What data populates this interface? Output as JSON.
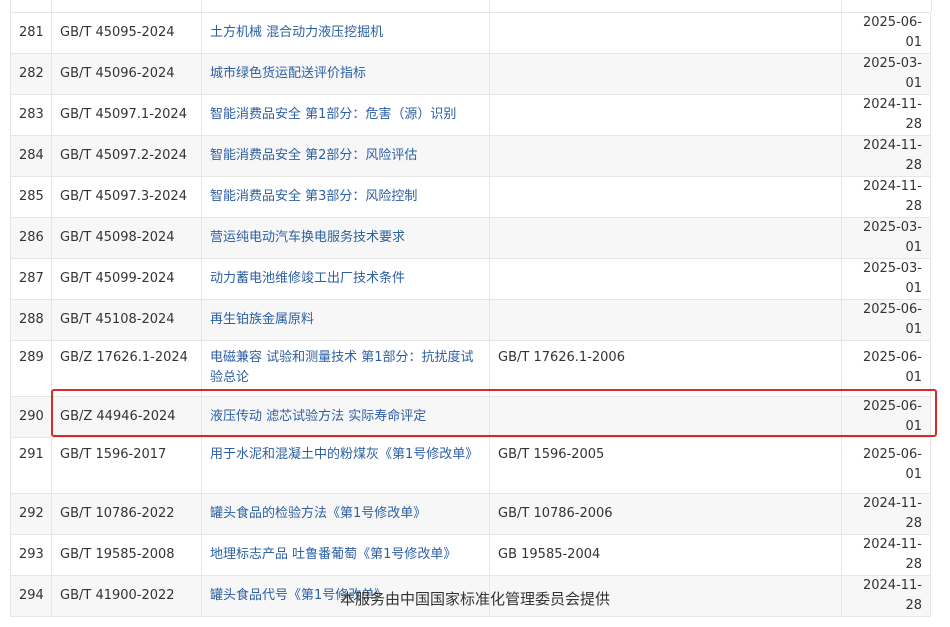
{
  "table": {
    "rows": [
      {
        "no": "281",
        "code": "GB/T 45095-2024",
        "name": "土方机械 混合动力液压挖掘机",
        "replaces": "",
        "date": "2025-06-01"
      },
      {
        "no": "282",
        "code": "GB/T 45096-2024",
        "name": "城市绿色货运配送评价指标",
        "replaces": "",
        "date": "2025-03-01"
      },
      {
        "no": "283",
        "code": "GB/T 45097.1-2024",
        "name": "智能消费品安全 第1部分：危害（源）识别",
        "replaces": "",
        "date": "2024-11-28"
      },
      {
        "no": "284",
        "code": "GB/T 45097.2-2024",
        "name": "智能消费品安全 第2部分：风险评估",
        "replaces": "",
        "date": "2024-11-28"
      },
      {
        "no": "285",
        "code": "GB/T 45097.3-2024",
        "name": "智能消费品安全 第3部分：风险控制",
        "replaces": "",
        "date": "2024-11-28"
      },
      {
        "no": "286",
        "code": "GB/T 45098-2024",
        "name": "营运纯电动汽车换电服务技术要求",
        "replaces": "",
        "date": "2025-03-01"
      },
      {
        "no": "287",
        "code": "GB/T 45099-2024",
        "name": "动力蓄电池维修竣工出厂技术条件",
        "replaces": "",
        "date": "2025-03-01"
      },
      {
        "no": "288",
        "code": "GB/T 45108-2024",
        "name": "再生铂族金属原料",
        "replaces": "",
        "date": "2025-06-01"
      },
      {
        "no": "289",
        "code": "GB/Z 17626.1-2024",
        "name": "电磁兼容 试验和测量技术 第1部分：抗扰度试验总论",
        "replaces": "GB/T 17626.1-2006",
        "date": "2025-06-01"
      },
      {
        "no": "290",
        "code": "GB/Z 44946-2024",
        "name": "液压传动 滤芯试验方法 实际寿命评定",
        "replaces": "",
        "date": "2025-06-01"
      },
      {
        "no": "291",
        "code": "GB/T 1596-2017",
        "name": "用于水泥和混凝土中的粉煤灰《第1号修改单》",
        "replaces": "GB/T 1596-2005",
        "date": "2025-06-01"
      },
      {
        "no": "292",
        "code": "GB/T 10786-2022",
        "name": "罐头食品的检验方法《第1号修改单》",
        "replaces": "GB/T 10786-2006",
        "date": "2024-11-28"
      },
      {
        "no": "293",
        "code": "GB/T 19585-2008",
        "name": "地理标志产品 吐鲁番葡萄《第1号修改单》",
        "replaces": "GB 19585-2004",
        "date": "2024-11-28"
      },
      {
        "no": "294",
        "code": "GB/T 41900-2022",
        "name": "罐头食品代号《第1号修改单》",
        "replaces": "",
        "date": "2024-11-28"
      }
    ]
  },
  "footer": {
    "text": "本服务由中国国家标准化管理委员会提供"
  },
  "colors": {
    "link": "#2c5fa3",
    "highlight": "#d42a2a",
    "stripe": "#f7f7f7"
  }
}
